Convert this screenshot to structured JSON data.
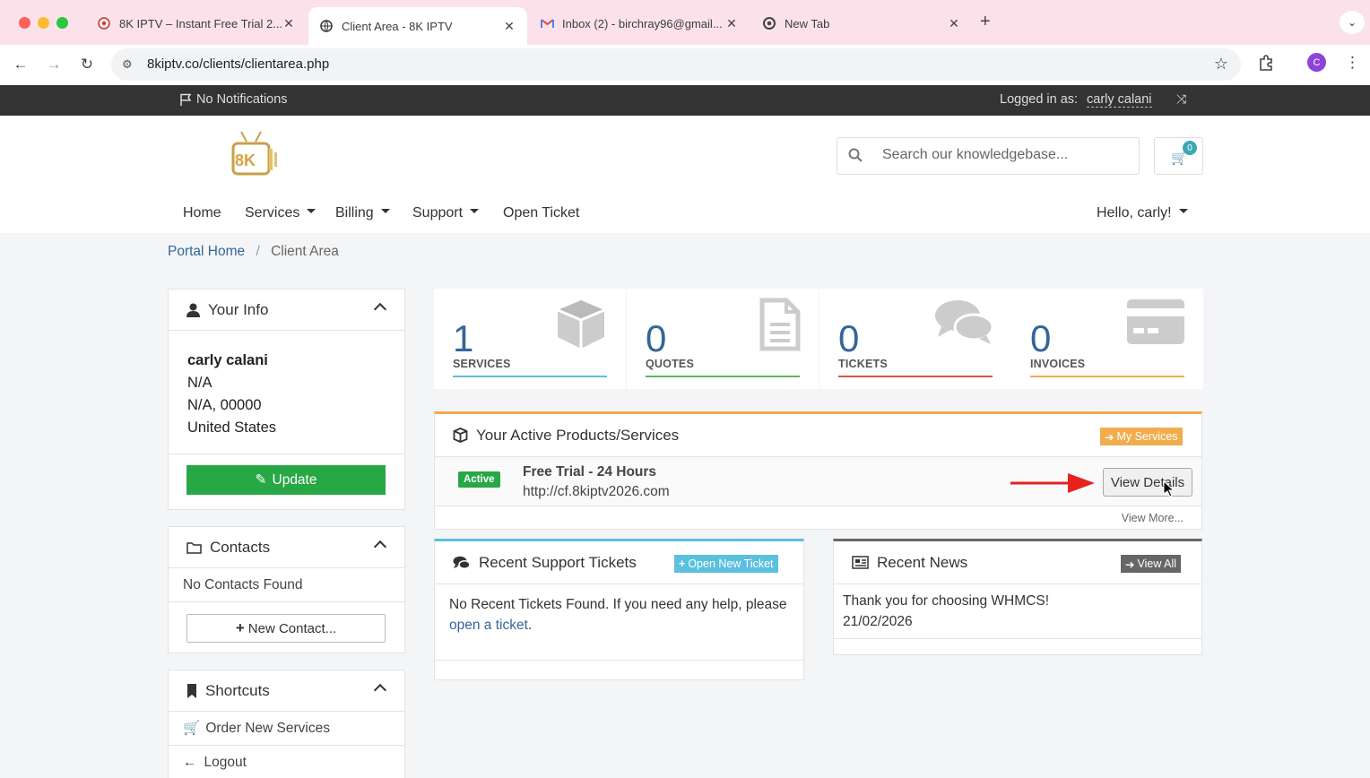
{
  "browser": {
    "tabs": [
      {
        "title": "8K IPTV – Instant Free Trial 2...",
        "active": false
      },
      {
        "title": "Client Area - 8K IPTV",
        "active": true
      },
      {
        "title": "Inbox (2) - birchray96@gmail...",
        "active": false
      },
      {
        "title": "New Tab",
        "active": false
      }
    ],
    "url": "8kiptv.co/clients/clientarea.php",
    "profile_initial": "C"
  },
  "topbar": {
    "notifications": "No Notifications",
    "logged_in_label": "Logged in as:",
    "user_name": "carly calani"
  },
  "header": {
    "logo_text": "8K",
    "search_placeholder": "Search our knowledgebase...",
    "cart_count": "0"
  },
  "nav": {
    "home": "Home",
    "services": "Services",
    "billing": "Billing",
    "support": "Support",
    "open_ticket": "Open Ticket",
    "greeting": "Hello, carly!"
  },
  "breadcrumb": {
    "home": "Portal Home",
    "separator": "/",
    "current": "Client Area"
  },
  "your_info": {
    "title": "Your Info",
    "name": "carly calani",
    "line1": "N/A",
    "line2": "N/A, 00000",
    "country": "United States",
    "update_label": "Update"
  },
  "contacts": {
    "title": "Contacts",
    "empty": "No Contacts Found",
    "new_label": "New Contact..."
  },
  "shortcuts": {
    "title": "Shortcuts",
    "order": "Order New Services",
    "logout": "Logout"
  },
  "stats": [
    {
      "value": "1",
      "label": "SERVICES",
      "color": "#5bc0de"
    },
    {
      "value": "0",
      "label": "QUOTES",
      "color": "#5cb85c"
    },
    {
      "value": "0",
      "label": "TICKETS",
      "color": "#d9534f"
    },
    {
      "value": "0",
      "label": "INVOICES",
      "color": "#f0ad4e"
    }
  ],
  "products": {
    "title": "Your Active Products/Services",
    "my_services": "My Services",
    "status": "Active",
    "product_name": "Free Trial - 24 Hours",
    "product_url": "http://cf.8kiptv2026.com",
    "view_details": "View Details",
    "view_more": "View More..."
  },
  "tickets": {
    "title": "Recent Support Tickets",
    "open_new": "Open New Ticket",
    "body": "No Recent Tickets Found. If you need any help, please",
    "link": "open a ticket",
    "period": "."
  },
  "news": {
    "title": "Recent News",
    "view_all": "View All",
    "headline": "Thank you for choosing WHMCS!",
    "date": "21/02/2026"
  },
  "colors": {
    "accent_link": "#336699",
    "orange": "#f0ad4e",
    "green": "#28a745",
    "info": "#5bc0de",
    "dark_bar": "#333333"
  }
}
